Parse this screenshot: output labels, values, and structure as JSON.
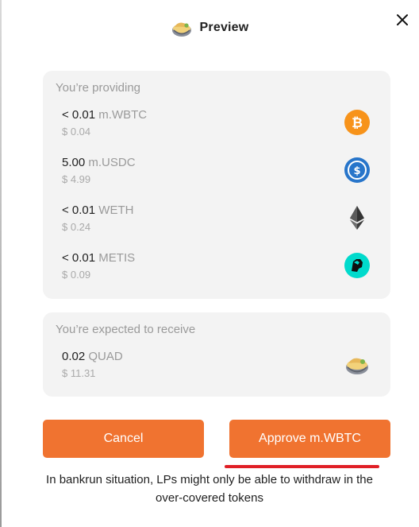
{
  "header": {
    "title": "Preview"
  },
  "providing": {
    "heading": "You’re providing",
    "items": [
      {
        "amount": "< 0.01",
        "symbol": "m.WBTC",
        "usd": "$ 0.04",
        "icon": "bitcoin-icon"
      },
      {
        "amount": "5.00",
        "symbol": "m.USDC",
        "usd": "$ 4.99",
        "icon": "usdc-icon"
      },
      {
        "amount": "< 0.01",
        "symbol": "WETH",
        "usd": "$ 0.24",
        "icon": "ethereum-icon"
      },
      {
        "amount": "< 0.01",
        "symbol": "METIS",
        "usd": "$ 0.09",
        "icon": "metis-icon"
      }
    ]
  },
  "receive": {
    "heading": "You’re expected to receive",
    "items": [
      {
        "amount": "0.02",
        "symbol": "QUAD",
        "usd": "$ 11.31",
        "icon": "quad-icon"
      }
    ]
  },
  "buttons": {
    "cancel": "Cancel",
    "approve": "Approve m.WBTC"
  },
  "note": "In bankrun situation, LPs might only be able to withdraw in the over-covered tokens",
  "colors": {
    "accent": "#f07330",
    "bitcoin": "#f7931a",
    "usdc": "#2775ca",
    "metis": "#00dacc",
    "highlight": "#e01f26"
  }
}
